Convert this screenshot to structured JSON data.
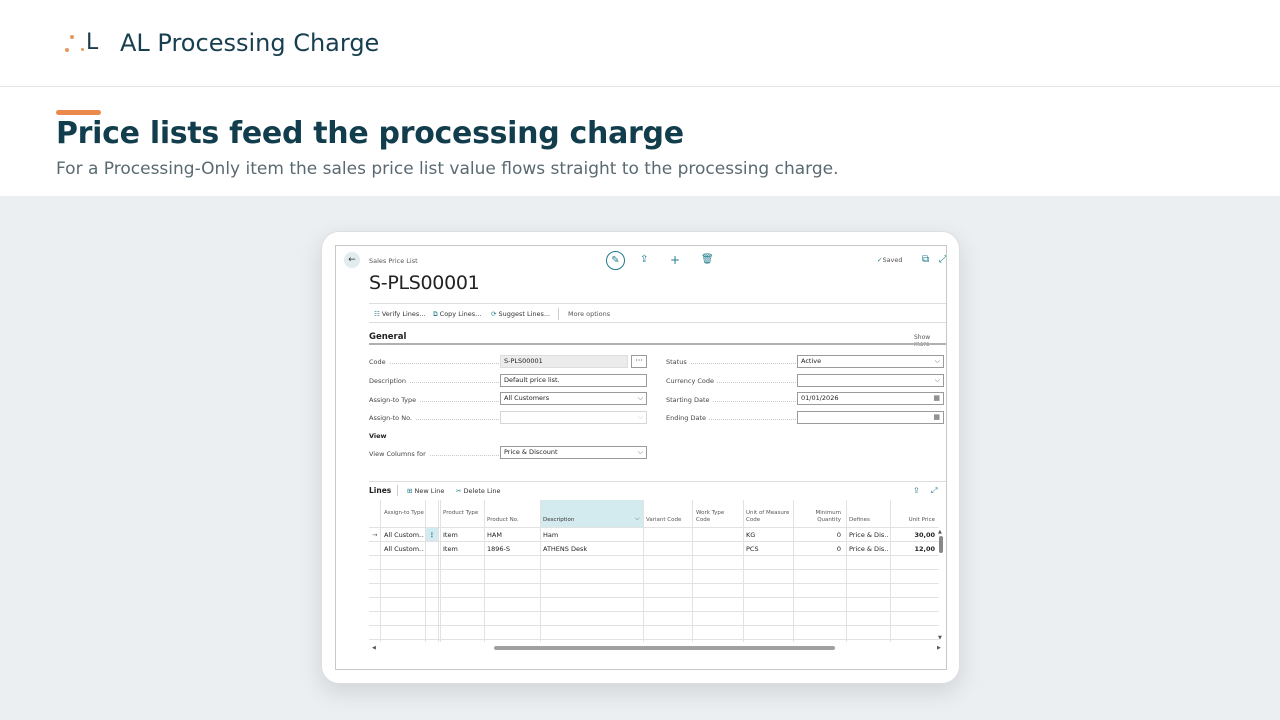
{
  "app": {
    "logo_letter": "L",
    "title": "AL Processing Charge"
  },
  "hero": {
    "heading": "Price lists feed the processing charge",
    "subheading": "For a Processing-Only item the sales price list value flows straight to the processing charge."
  },
  "screen": {
    "breadcrumb": "Sales Price List",
    "doc_title": "S-PLS00001",
    "saved_label": "Saved",
    "actions": [
      {
        "label": "Verify Lines..."
      },
      {
        "label": "Copy Lines..."
      },
      {
        "label": "Suggest Lines..."
      },
      {
        "label": "More options"
      }
    ],
    "general": {
      "title": "General",
      "show_more": "Show more",
      "fields_left": [
        {
          "label": "Code",
          "value": "S-PLS00001"
        },
        {
          "label": "Description",
          "value": "Default price list."
        },
        {
          "label": "Assign-to Type",
          "value": "All Customers"
        },
        {
          "label": "Assign-to No.",
          "value": ""
        }
      ],
      "view_group": "View",
      "view_columns": {
        "label": "View Columns for",
        "value": "Price & Discount"
      },
      "fields_right": [
        {
          "label": "Status",
          "value": "Active"
        },
        {
          "label": "Currency Code",
          "value": ""
        },
        {
          "label": "Starting Date",
          "value": "01/01/2026"
        },
        {
          "label": "Ending Date",
          "value": ""
        }
      ]
    },
    "lines": {
      "title": "Lines",
      "new_line": "New Line",
      "delete_line": "Delete Line",
      "columns": [
        "Assign-to Type",
        "Product Type",
        "Product No.",
        "Description",
        "Variant Code",
        "Work Type Code",
        "Unit of Measure Code",
        "Minimum Quantity",
        "Defines",
        "Unit Price"
      ],
      "rows": [
        {
          "assign": "All Custom...",
          "ptype": "Item",
          "pno": "HAM",
          "desc": "Ham",
          "variant": "",
          "work": "",
          "uom": "KG",
          "minqty": "0",
          "defines": "Price & Dis...",
          "price": "30,00"
        },
        {
          "assign": "All Custom...",
          "ptype": "Item",
          "pno": "1896-S",
          "desc": "ATHENS Desk",
          "variant": "",
          "work": "",
          "uom": "PCS",
          "minqty": "0",
          "defines": "Price & Dis...",
          "price": "12,00"
        }
      ]
    }
  },
  "colors": {
    "accent": "#ec8a4e",
    "brand": "#123d4d",
    "bc_teal": "#1f7a8c"
  }
}
